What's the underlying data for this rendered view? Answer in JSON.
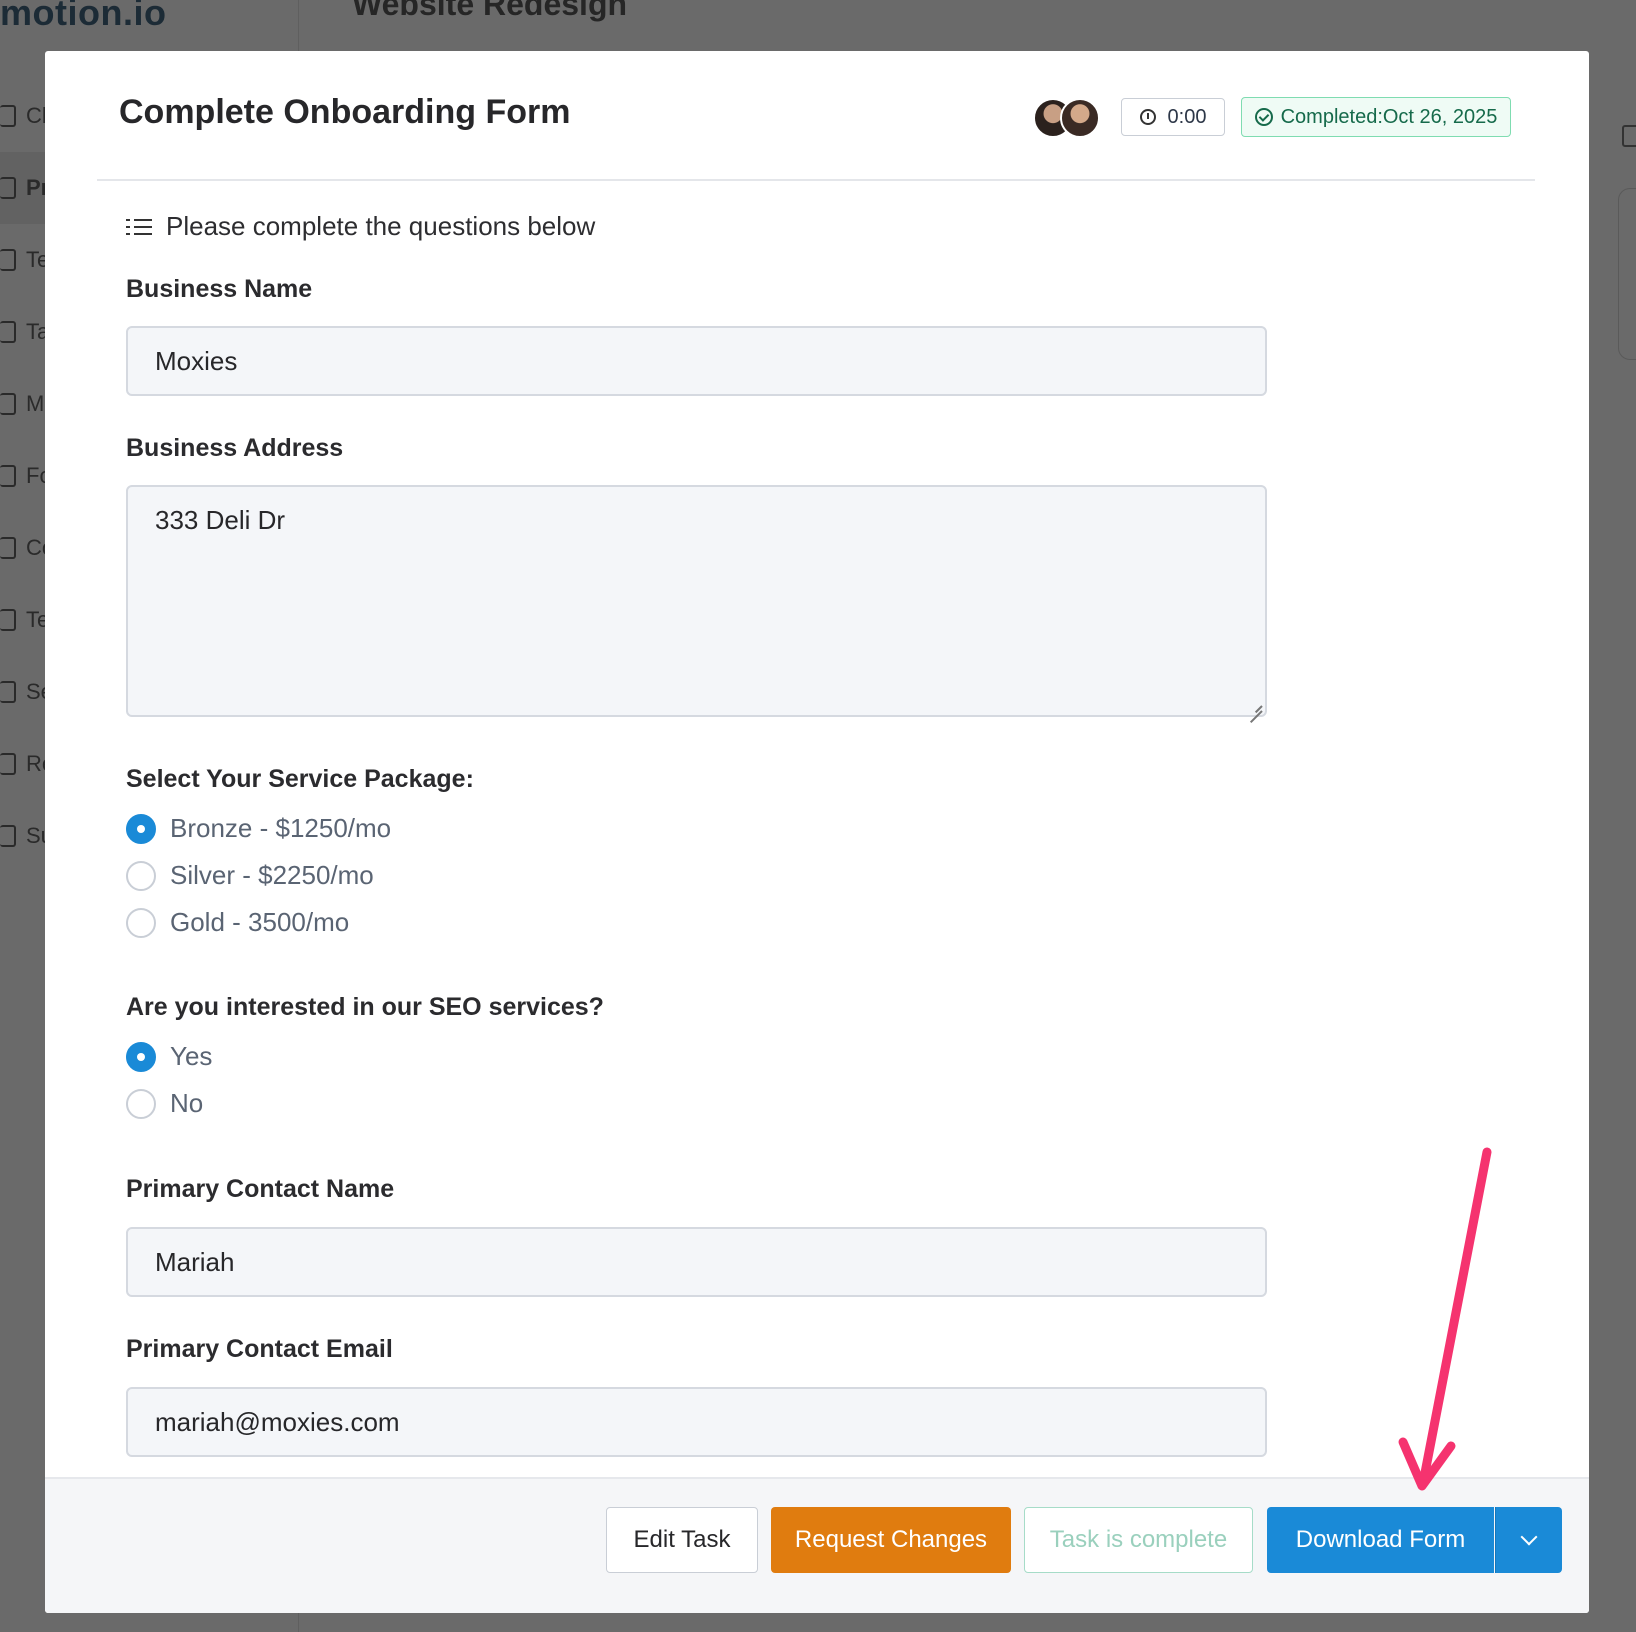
{
  "background": {
    "logo": "motion.io",
    "project_title": "Website Redesign",
    "nav_items": [
      "Cl",
      "Pr",
      "Te",
      "Ta",
      "M",
      "Fo",
      "Co",
      "Te",
      "Se",
      "Re",
      "Su"
    ]
  },
  "modal": {
    "title": "Complete Onboarding Form",
    "timer": "0:00",
    "completed_badge": "Completed:Oct 26, 2025",
    "intro": "Please complete the questions below",
    "fields": {
      "business_name": {
        "label": "Business Name",
        "value": "Moxies"
      },
      "business_address": {
        "label": "Business Address",
        "value": "333 Deli Dr"
      },
      "service_package": {
        "label": "Select Your Service Package:",
        "options": [
          "Bronze - $1250/mo",
          "Silver - $2250/mo",
          "Gold - 3500/mo"
        ],
        "selected": "Bronze - $1250/mo"
      },
      "seo": {
        "label": "Are you interested in our SEO services?",
        "options": [
          "Yes",
          "No"
        ],
        "selected": "Yes"
      },
      "contact_name": {
        "label": "Primary Contact Name",
        "value": "Mariah"
      },
      "contact_email": {
        "label": "Primary Contact Email",
        "value": "mariah@moxies.com"
      }
    },
    "footer": {
      "edit_task": "Edit Task",
      "request_changes": "Request Changes",
      "task_complete": "Task is complete",
      "download_form": "Download Form"
    }
  },
  "colors": {
    "primary_blue": "#1a8ad7",
    "request_orange": "#e07c0f",
    "completed_green": "#166a4b",
    "annotation_arrow": "#f5336f"
  },
  "icons": {
    "timer": "stopwatch-icon",
    "completed": "check-circle-icon",
    "intro": "list-checks-icon",
    "dropdown": "chevron-down-icon"
  }
}
